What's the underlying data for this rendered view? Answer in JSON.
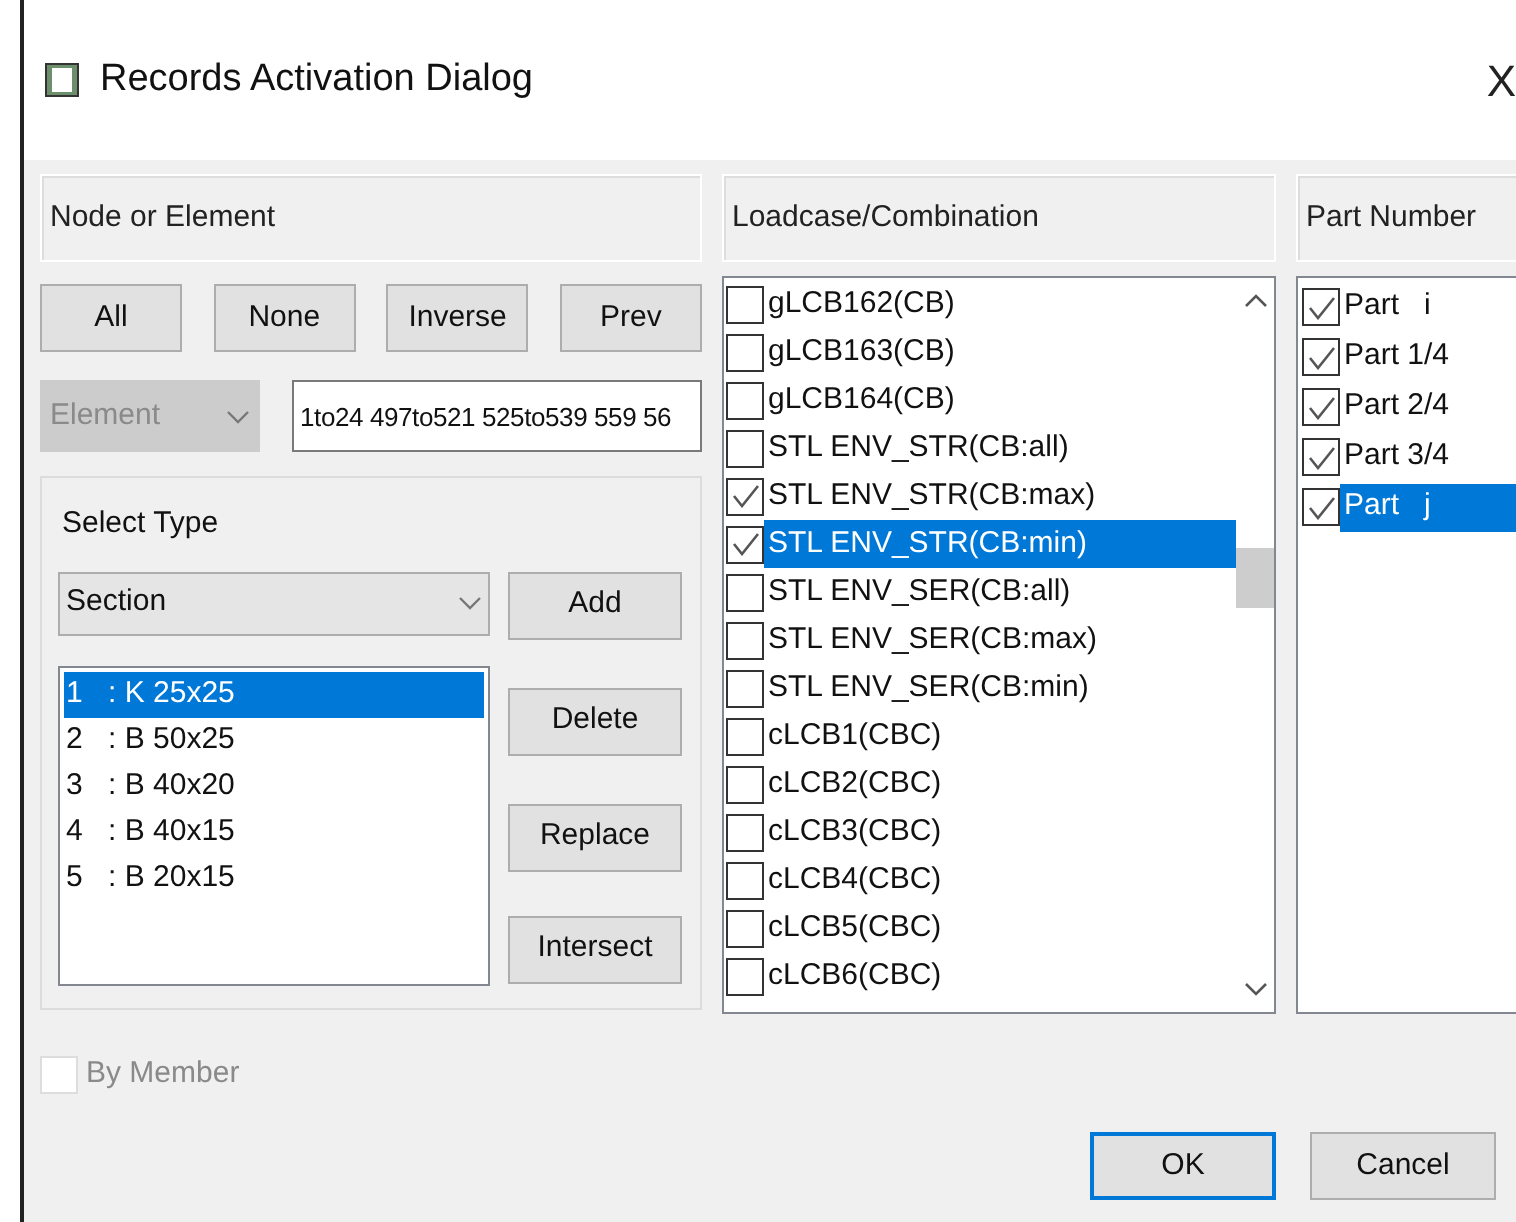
{
  "window": {
    "title": "Records Activation Dialog",
    "close": "X"
  },
  "node_or_element": {
    "header": "Node or Element",
    "buttons": [
      "All",
      "None",
      "Inverse",
      "Prev"
    ],
    "type_combo": {
      "value": "Element",
      "disabled": true
    },
    "list_field": {
      "value": "1to24 497to521 525to539 559 56"
    }
  },
  "select_type": {
    "label": "Select Type",
    "combo": {
      "value": "Section"
    },
    "items": [
      {
        "number": "1",
        "text": ": K 25x25",
        "selected": true
      },
      {
        "number": "2",
        "text": ": B 50x25",
        "selected": false
      },
      {
        "number": "3",
        "text": ": B 40x20",
        "selected": false
      },
      {
        "number": "4",
        "text": ": B 40x15",
        "selected": false
      },
      {
        "number": "5",
        "text": ": B 20x15",
        "selected": false
      }
    ],
    "side_buttons": [
      "Add",
      "Delete",
      "Replace",
      "Intersect"
    ]
  },
  "by_member": {
    "label": "By Member",
    "checked": false,
    "disabled": true
  },
  "loadcase": {
    "header": "Loadcase/Combination",
    "items": [
      {
        "label": "gLCB162(CB)",
        "checked": false,
        "selected": false
      },
      {
        "label": "gLCB163(CB)",
        "checked": false,
        "selected": false
      },
      {
        "label": "gLCB164(CB)",
        "checked": false,
        "selected": false
      },
      {
        "label": "STL ENV_STR(CB:all)",
        "checked": false,
        "selected": false
      },
      {
        "label": "STL ENV_STR(CB:max)",
        "checked": true,
        "selected": false
      },
      {
        "label": "STL ENV_STR(CB:min)",
        "checked": true,
        "selected": true
      },
      {
        "label": "STL ENV_SER(CB:all)",
        "checked": false,
        "selected": false
      },
      {
        "label": "STL ENV_SER(CB:max)",
        "checked": false,
        "selected": false
      },
      {
        "label": "STL ENV_SER(CB:min)",
        "checked": false,
        "selected": false
      },
      {
        "label": "cLCB1(CBC)",
        "checked": false,
        "selected": false
      },
      {
        "label": "cLCB2(CBC)",
        "checked": false,
        "selected": false
      },
      {
        "label": "cLCB3(CBC)",
        "checked": false,
        "selected": false
      },
      {
        "label": "cLCB4(CBC)",
        "checked": false,
        "selected": false
      },
      {
        "label": "cLCB5(CBC)",
        "checked": false,
        "selected": false
      },
      {
        "label": "cLCB6(CBC)",
        "checked": false,
        "selected": false
      }
    ]
  },
  "part_number": {
    "header": "Part Number",
    "items": [
      {
        "label": "Part   i",
        "checked": true,
        "selected": false
      },
      {
        "label": "Part 1/4",
        "checked": true,
        "selected": false
      },
      {
        "label": "Part 2/4",
        "checked": true,
        "selected": false
      },
      {
        "label": "Part 3/4",
        "checked": true,
        "selected": false
      },
      {
        "label": "Part   j",
        "checked": true,
        "selected": true
      }
    ]
  },
  "footer_buttons": [
    {
      "label": "OK",
      "default": true
    },
    {
      "label": "Cancel",
      "default": false
    }
  ]
}
